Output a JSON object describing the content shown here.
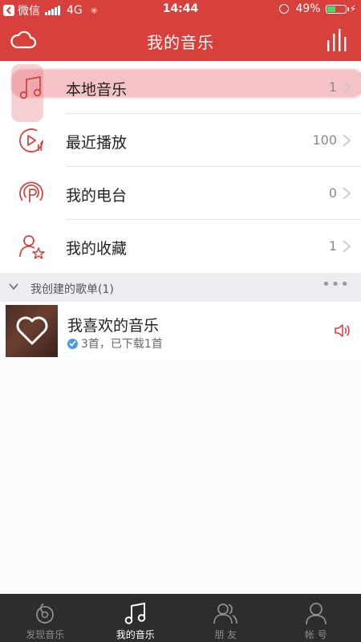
{
  "status_bar": {
    "back_app": "微信",
    "network": "4G",
    "spinner": "✳",
    "time": "14:44",
    "battery": "49%",
    "battery_level": 0.49
  },
  "header": {
    "title": "我的音乐",
    "left_icon": "cloud-icon",
    "right_icon": "equalizer-bars-icon"
  },
  "menu": {
    "items": [
      {
        "label": "本地音乐",
        "count": "1",
        "icon": "music-note-icon"
      },
      {
        "label": "最近播放",
        "count": "100",
        "icon": "recent-play-icon"
      },
      {
        "label": "我的电台",
        "count": "0",
        "icon": "radio-icon"
      },
      {
        "label": "我的收藏",
        "count": "1",
        "icon": "favorite-user-icon"
      }
    ]
  },
  "playlists": {
    "header": "我创建的歌单(1)",
    "more": "•••",
    "items": [
      {
        "title": "我喜欢的音乐",
        "subtitle": "3首，已下载1首"
      }
    ]
  },
  "tabbar": {
    "tabs": [
      {
        "label": "发现音乐",
        "icon": "discover-icon",
        "active": false
      },
      {
        "label": "我的音乐",
        "icon": "music-icon",
        "active": true
      },
      {
        "label": "朋 友",
        "icon": "friends-icon",
        "active": false
      },
      {
        "label": "帐 号",
        "icon": "account-icon",
        "active": false
      }
    ]
  },
  "colors": {
    "brand_red": "#d8403b",
    "tabbar_bg": "#2d2d30",
    "icon_red": "#c94a45"
  }
}
